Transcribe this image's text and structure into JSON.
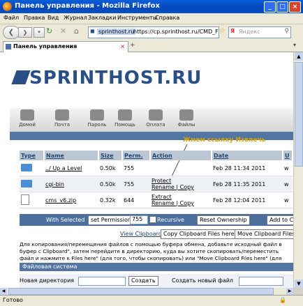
{
  "window": {
    "title": "Панель управления - Mozilla Firefox"
  },
  "menu": [
    "Файл",
    "Правка",
    "Вид",
    "Журнал",
    "Закладки",
    "Инструменты",
    "Справка"
  ],
  "address": {
    "host": "sprinthost.ru",
    "url": "https://cp.sprinthost.ru/CMD_F"
  },
  "search": {
    "placeholder": "Яндекс"
  },
  "tab": {
    "label": "Панель управления"
  },
  "logo": {
    "text": "SPRINTHOST.RU"
  },
  "nav": [
    "Домой",
    "Почта",
    "Пароль",
    "Помощь",
    "Оплата",
    "Файлы"
  ],
  "callout": "Жмем ссылку Извлечь",
  "table": {
    "headers": [
      "Type",
      "Name",
      "Size",
      "Perm.",
      "Action",
      "Date",
      "U"
    ],
    "rows": [
      {
        "name": "../ Up a Level",
        "size": "0.50k",
        "perm": "755",
        "action1": "",
        "action2": "",
        "date": "Feb 28 11:34 2011",
        "u": "w"
      },
      {
        "name": "cgi-bin",
        "size": "0.50k",
        "perm": "755",
        "action1": "Protect",
        "action2": "Rename | Copy",
        "date": "Feb 28 11:35 2011",
        "u": "w"
      },
      {
        "name": "cms_v6.zip",
        "size": "0.32k",
        "perm": "644",
        "action1": "Extract",
        "action2": "Rename | Copy",
        "date": "Feb 28 12:04 2011",
        "u": "w"
      }
    ]
  },
  "actionbar": {
    "label": "With Selected",
    "set_permission": "set Permission",
    "perm_value": "755",
    "recursive": "Recursive",
    "reset": "Reset Ownership",
    "add": "Add to Cli"
  },
  "clipboard": {
    "view": "View Clipboard",
    "copy": "Copy Clipboard Files here",
    "move": "Move Clipboard Files h"
  },
  "note": "Для копирования/перемещения файлов с помощью буфера обмена, добавьте исходный файл в буфер с Clipboard\", затем перейдите в директорию, куда вы хотите скопировать/переместить файл и нажмите к Files here\" (для того, чтобы скопировать) или \"Move Clipboard Files here\" (для того, чтобы переместить).",
  "filesystem": {
    "title": "Файловая система",
    "new_dir_label": "Новая директория",
    "create_btn": "Создать",
    "new_file_label": "Создать новый файл"
  },
  "status": "Готово"
}
